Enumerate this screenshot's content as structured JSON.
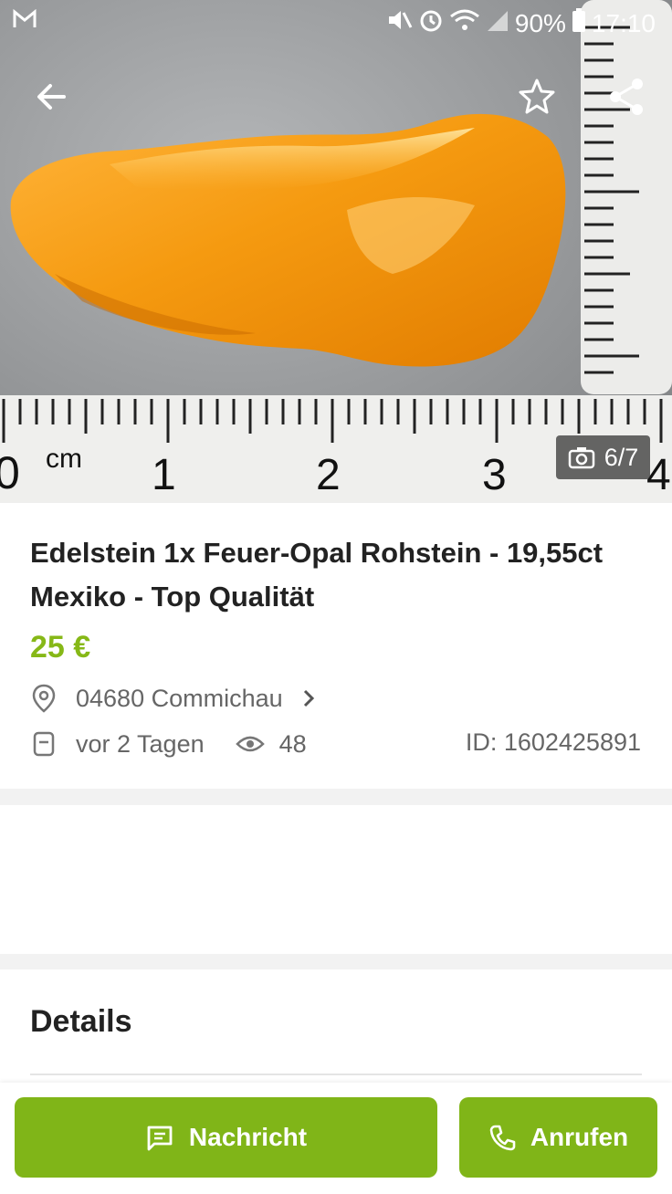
{
  "status_bar": {
    "battery": "90%",
    "time": "17:10"
  },
  "gallery": {
    "counter": "6/7"
  },
  "listing": {
    "title": "Edelstein 1x Feuer-Opal Rohstein - 19,55ct  Mexiko - Top Qualität",
    "price": "25 €",
    "location": "04680 Commichau",
    "posted": "vor 2 Tagen",
    "views": "48",
    "id": "ID: 1602425891"
  },
  "details": {
    "heading": "Details"
  },
  "actions": {
    "message_label": "Nachricht",
    "call_label": "Anrufen"
  },
  "colors": {
    "accent": "#80b518",
    "price": "#86b817"
  },
  "icons": [
    "gmail-icon",
    "mute-icon",
    "alarm-icon",
    "wifi-icon",
    "signal-icon",
    "battery-icon",
    "back-arrow-icon",
    "star-icon",
    "share-icon",
    "camera-icon",
    "location-pin-icon",
    "chevron-right-icon",
    "calendar-icon",
    "eye-icon",
    "message-icon",
    "phone-icon"
  ]
}
